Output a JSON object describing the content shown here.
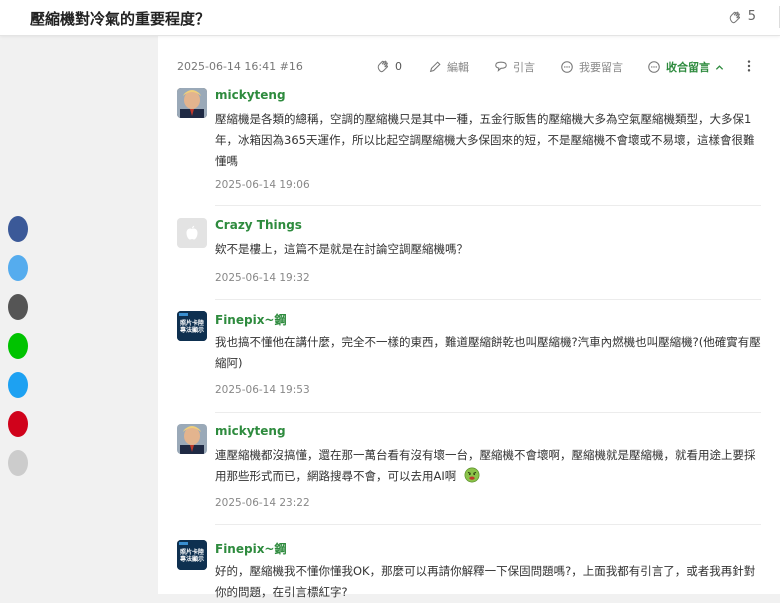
{
  "page": {
    "title": "壓縮機對冷氣的重要程度？",
    "clap_count": "5"
  },
  "post": {
    "timestamp": "2025-06-14 16:41 #16",
    "like_count": "0",
    "edit_label": "編輯",
    "quote_label": "引言",
    "reply_label": "我要留言",
    "collapse_label": "收合留言"
  },
  "comments": [
    {
      "author": "mickyteng",
      "text": "壓縮機是各類的總稱，空調的壓縮機只是其中一種，五金行販售的壓縮機大多為空氣壓縮機類型，大多保1年，冰箱因為365天運作，所以比起空調壓縮機大多保固來的短，不是壓縮機不會壞或不易壞，這樣會很難懂嗎",
      "time": "2025-06-14 19:06"
    },
    {
      "author": "Crazy Things",
      "text": "欸不是樓上，這篇不是就是在討論空調壓縮機嗎？",
      "time": "2025-06-14 19:32"
    },
    {
      "author": "Finepix~鋼",
      "text": "我也搞不懂他在講什麼，完全不一樣的東西，難道壓縮餅乾也叫壓縮機?汽車內燃機也叫壓縮機?(他確實有壓縮阿)",
      "time": "2025-06-14 19:53"
    },
    {
      "author": "mickyteng",
      "text": "連壓縮機都沒搞懂，還在那一萬台看有沒有壞一台，壓縮機不會壞啊，壓縮機就是壓縮機，就看用途上要採用那些形式而已，網路搜尋不會，可以去用AI啊",
      "time": "2025-06-14 23:22"
    },
    {
      "author": "Finepix~鋼",
      "text": "好的，壓縮機我不懂你懂我OK，那麼可以再請你解釋一下保固問題嗎?，上面我都有引言了，或者我再針對你的問題，在引言標紅字?",
      "time": ""
    }
  ],
  "avatar_texts": {
    "finepix_line1": "照片卡陸",
    "finepix_line2": "專法顯示"
  },
  "colors": {
    "accent_green": "#2e8b3e",
    "social": [
      "#3b5998",
      "#55acee",
      "#555555",
      "#00c300",
      "#1da1f2",
      "#d0021b",
      "#cccccc"
    ]
  }
}
